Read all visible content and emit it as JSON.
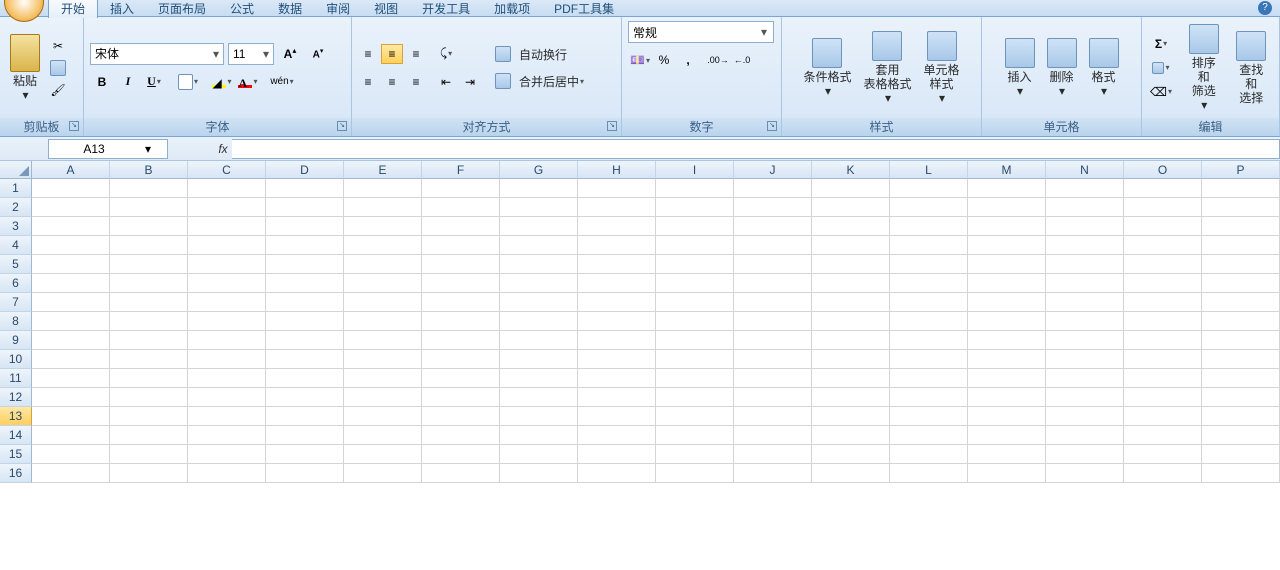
{
  "tabs": {
    "items": [
      "开始",
      "插入",
      "页面布局",
      "公式",
      "数据",
      "审阅",
      "视图",
      "开发工具",
      "加载项",
      "PDF工具集"
    ],
    "active": 0
  },
  "ribbon": {
    "clipboard": {
      "paste": "粘贴",
      "label": "剪贴板"
    },
    "font": {
      "name": "宋体",
      "size": "11",
      "label": "字体",
      "bold": "B",
      "italic": "I",
      "underline": "U"
    },
    "alignment": {
      "label": "对齐方式",
      "wrap": "自动换行",
      "merge": "合并后居中"
    },
    "number": {
      "format": "常规",
      "label": "数字"
    },
    "styles": {
      "label": "样式",
      "cond": "条件格式",
      "table": "套用\n表格格式",
      "cell": "单元格\n样式"
    },
    "cells": {
      "label": "单元格",
      "insert": "插入",
      "delete": "删除",
      "format": "格式"
    },
    "editing": {
      "label": "编辑",
      "sort": "排序和\n筛选",
      "find": "查找和\n选择"
    }
  },
  "namebox": {
    "value": "A13"
  },
  "formula": {
    "fx": "fx"
  },
  "grid": {
    "cols": [
      "A",
      "B",
      "C",
      "D",
      "E",
      "F",
      "G",
      "H",
      "I",
      "J",
      "K",
      "L",
      "M",
      "N",
      "O",
      "P"
    ],
    "rows": [
      1,
      2,
      3,
      4,
      5,
      6,
      7,
      8,
      9,
      10,
      11,
      12,
      13,
      14,
      15,
      16
    ],
    "selected_row": 13
  }
}
